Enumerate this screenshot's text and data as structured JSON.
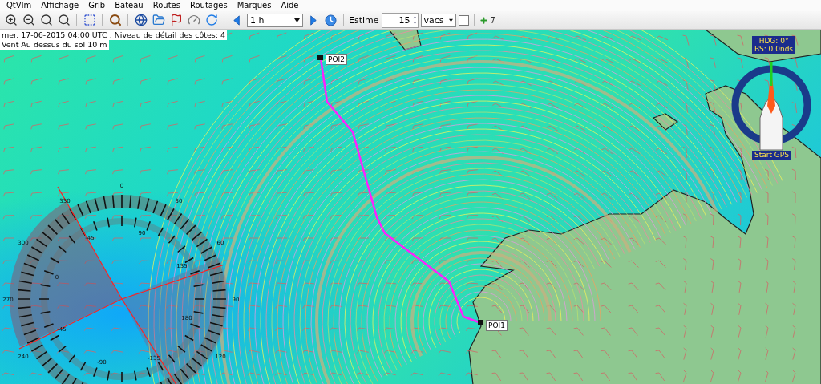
{
  "menu": [
    "QtVlm",
    "Affichage",
    "Grib",
    "Bateau",
    "Routes",
    "Routages",
    "Marques",
    "Aide"
  ],
  "toolbar": {
    "time_step": "1 h",
    "estime_label": "Estime",
    "estime_value": "15",
    "estime_unit": "vacs",
    "estime_checked": false,
    "extra": "7"
  },
  "map": {
    "info_lines": [
      "mer. 17-06-2015 04:00 UTC . Niveau de détail des côtes: 4",
      "Vent Au dessus du sol 10 m"
    ],
    "pois": [
      {
        "label": "POI2"
      },
      {
        "label": "POI1"
      }
    ],
    "boat_compass": {
      "heading": "HDG: 0°",
      "speed": "BS: 0.0nds",
      "gps_button": "Start GPS"
    },
    "compass_rose": {
      "outer_labels": [
        "0",
        "30",
        "60",
        "90",
        "120",
        "240",
        "270",
        "300",
        "330"
      ],
      "inner_labels": [
        "-45",
        "90",
        "135",
        "180",
        "-135",
        "-90",
        "-45",
        "0"
      ]
    }
  }
}
